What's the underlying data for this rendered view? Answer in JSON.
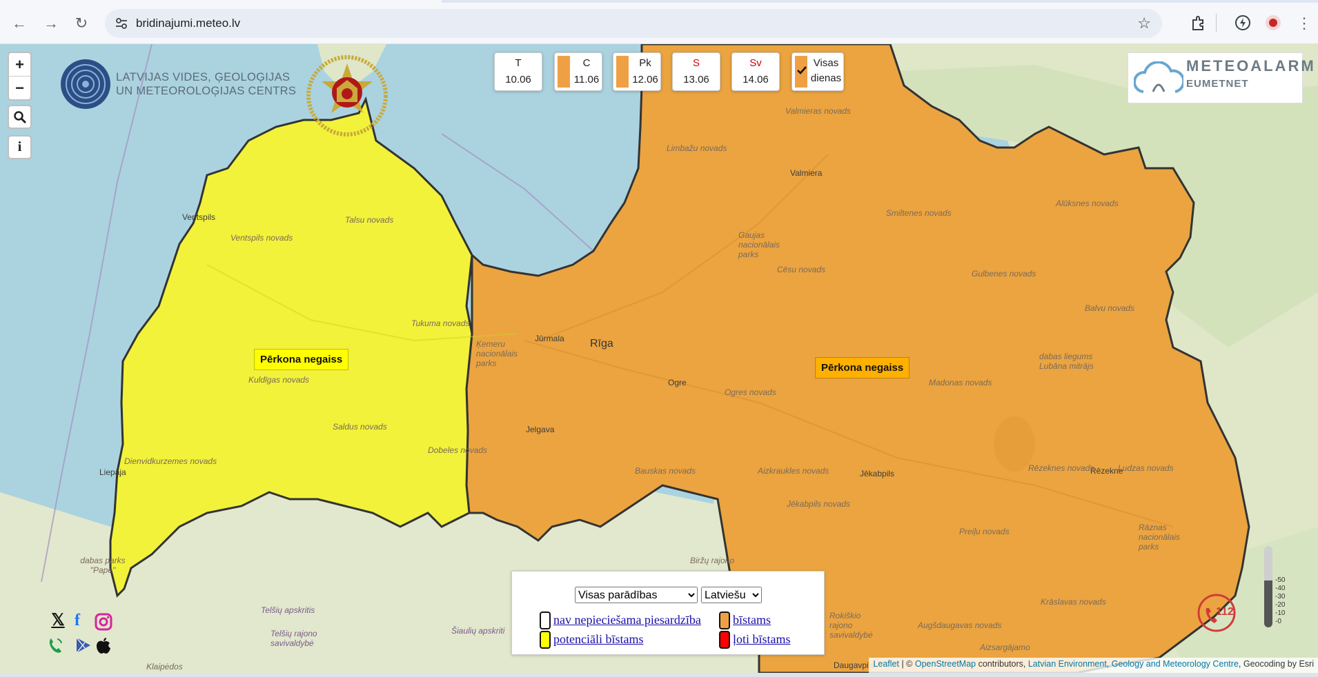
{
  "browser": {
    "url": "bridinajumi.meteo.lv"
  },
  "logo": {
    "line1": "LATVIJAS VIDES, ĢEOLOĢIJAS",
    "line2": "UN METEOROLOĢIJAS CENTRS"
  },
  "days": [
    {
      "day": "T",
      "date": "10.06",
      "day_color": "#222222",
      "level_color": null
    },
    {
      "day": "C",
      "date": "11.06",
      "day_color": "#222222",
      "level_color": "#f0a044"
    },
    {
      "day": "Pk",
      "date": "12.06",
      "day_color": "#222222",
      "level_color": "#f0a044"
    },
    {
      "day": "S",
      "date": "13.06",
      "day_color": "#d00000",
      "level_color": null
    },
    {
      "day": "Sv",
      "date": "14.06",
      "day_color": "#d00000",
      "level_color": null
    }
  ],
  "all_days": {
    "line1": "Visas",
    "line2": "dienas",
    "checked": true
  },
  "meteoalarm": {
    "title": "METEOALARM",
    "subtitle": "EUMETNET"
  },
  "warnings": [
    {
      "text": "Pērkona negaiss",
      "level": "yellow",
      "color": "#ffff00"
    },
    {
      "text": "Pērkona negaiss",
      "level": "orange",
      "color": "#ffb000"
    }
  ],
  "map_labels": {
    "cities": [
      "Ventspils",
      "Rīga",
      "Jūrmala",
      "Ogre",
      "Jelgava",
      "Liepāja",
      "Valmiera",
      "Jēkabpils",
      "Rēzekne",
      "Daugavpils"
    ],
    "regions": [
      "Valmieras novads",
      "Limbažu novads",
      "Ventspils novads",
      "Talsu novads",
      "Tukuma novads",
      "Kuldīgas novads",
      "Saldus novads",
      "Dobeles novads",
      "Dienvidkurzemes novads",
      "Bauskas novads",
      "Aizkraukles novads",
      "Jēkabpils novads",
      "Preiļu novads",
      "Rēzeknes novads",
      "Ludzas novads",
      "Balvu novads",
      "Gulbenes novads",
      "Alūksnes novads",
      "Smiltenes novads",
      "Cēsu novads",
      "Madonas novads",
      "Ogres novads",
      "Krāslavas novads",
      "Augšdaugavas novads",
      "Gaujas nacionālais parks",
      "Ķemeru nacionālais parks",
      "dabas liegums Lubāna mitrājs",
      "Rāznas nacionālais parks",
      "dabas parks \"Pape\"",
      "Telšių apskritis",
      "Telšių rajono savivaldybė",
      "Šiaulių apskriti",
      "Biržų rajono",
      "Rokiškio rajono savivaldybė",
      "Aizsargājamo",
      "Klaipėdos"
    ]
  },
  "legend": {
    "phenomena_select": "Visas parādības",
    "language_select": "Latviešu",
    "items": [
      {
        "label": "nav nepieciešama piesardzība",
        "color": "#ffffff"
      },
      {
        "label": "bīstams",
        "color": "#f0a044"
      },
      {
        "label": "potenciāli bīstams",
        "color": "#ffff00"
      },
      {
        "label": "ļoti bīstams",
        "color": "#ff0000"
      }
    ]
  },
  "scale_labels": [
    "-50",
    "-40",
    "-30",
    "-20",
    "-10",
    "-0"
  ],
  "attribution": {
    "leaflet": "Leaflet",
    "sep1": " | © ",
    "osm": "OpenStreetMap",
    "contrib": " contributors, ",
    "lvgmc": "Latvian Environment, Geology and Meteorology Centre",
    "geocoding": ", Geocoding by Esri"
  },
  "emergency_number": "112",
  "colors": {
    "yellow_zone": "#f2f23a",
    "orange_zone": "#eba440",
    "sea": "#aad3df",
    "land": "#dfe7c8"
  }
}
